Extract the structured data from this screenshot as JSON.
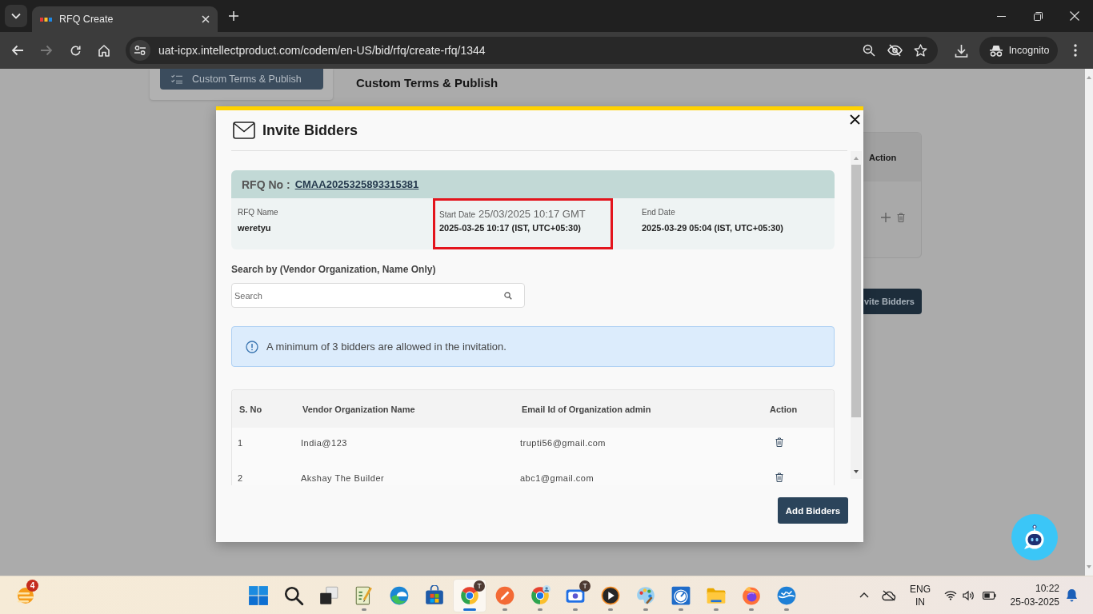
{
  "browser": {
    "tab": {
      "title": "RFQ Create"
    },
    "nav": [
      {
        "kind": "back",
        "disabled": false
      },
      {
        "kind": "forward",
        "disabled": true
      },
      {
        "kind": "reload",
        "disabled": false
      },
      {
        "kind": "home",
        "disabled": false
      }
    ],
    "url": "uat-icpx.intellectproduct.com/codem/en-US/bid/rfq/create-rfq/1344",
    "profile": "Incognito"
  },
  "page": {
    "sidebar_button": "Custom Terms & Publish",
    "heading": "Custom Terms & Publish",
    "table_column": "Action",
    "action_button": "vite Bidders"
  },
  "modal": {
    "title": "Invite Bidders",
    "rfq": {
      "label": "RFQ No :",
      "number": "CMAA2025325893315381"
    },
    "fields": [
      {
        "label": "RFQ Name",
        "value": "weretyu",
        "highlighted": false
      },
      {
        "label": "Start Date",
        "note": "25/03/2025 10:17 GMT",
        "value": "2025-03-25 10:17 (IST, UTC+05:30)",
        "highlighted": true
      },
      {
        "label": "End Date",
        "value": "2025-03-29 05:04 (IST, UTC+05:30)",
        "highlighted": false
      }
    ],
    "search_label": "Search by (Vendor Organization, Name Only)",
    "search": {
      "placeholder": "Search"
    },
    "info": "A minimum of 3 bidders are allowed in the invitation.",
    "table": {
      "columns": [
        "S. No",
        "Vendor Organization Name",
        "Email Id of Organization admin",
        "Action"
      ],
      "rows": [
        {
          "cells": [
            "1",
            "India@123",
            "trupti56@gmail.com"
          ]
        },
        {
          "cells": [
            "2",
            "Akshay The Builder",
            "abc1@gmail.com"
          ]
        }
      ]
    },
    "submit": "Add Bidders"
  },
  "taskbar": {
    "weather_badge": "4",
    "apps": [
      {
        "kind": "start",
        "running": false,
        "selected": false
      },
      {
        "kind": "search",
        "running": false,
        "selected": false
      },
      {
        "kind": "task-view",
        "running": false,
        "selected": false
      },
      {
        "kind": "notepad",
        "running": true,
        "selected": false
      },
      {
        "kind": "edge",
        "running": false,
        "selected": false
      },
      {
        "kind": "store",
        "running": false,
        "selected": false
      },
      {
        "kind": "chrome",
        "running": true,
        "selected": true,
        "badge": "T"
      },
      {
        "kind": "pen",
        "running": true,
        "selected": false
      },
      {
        "kind": "chrome-profile",
        "running": true,
        "selected": false
      },
      {
        "kind": "camera",
        "running": true,
        "selected": false,
        "badge": "T"
      },
      {
        "kind": "player",
        "running": true,
        "selected": false
      },
      {
        "kind": "paint",
        "running": true,
        "selected": false
      },
      {
        "kind": "gauge",
        "running": true,
        "selected": false
      },
      {
        "kind": "folder",
        "running": true,
        "selected": false
      },
      {
        "kind": "firefox",
        "running": true,
        "selected": false
      },
      {
        "kind": "birds",
        "running": true,
        "selected": false
      }
    ],
    "language": "ENG",
    "region": "IN",
    "time": "10:22",
    "date": "25-03-2025"
  }
}
